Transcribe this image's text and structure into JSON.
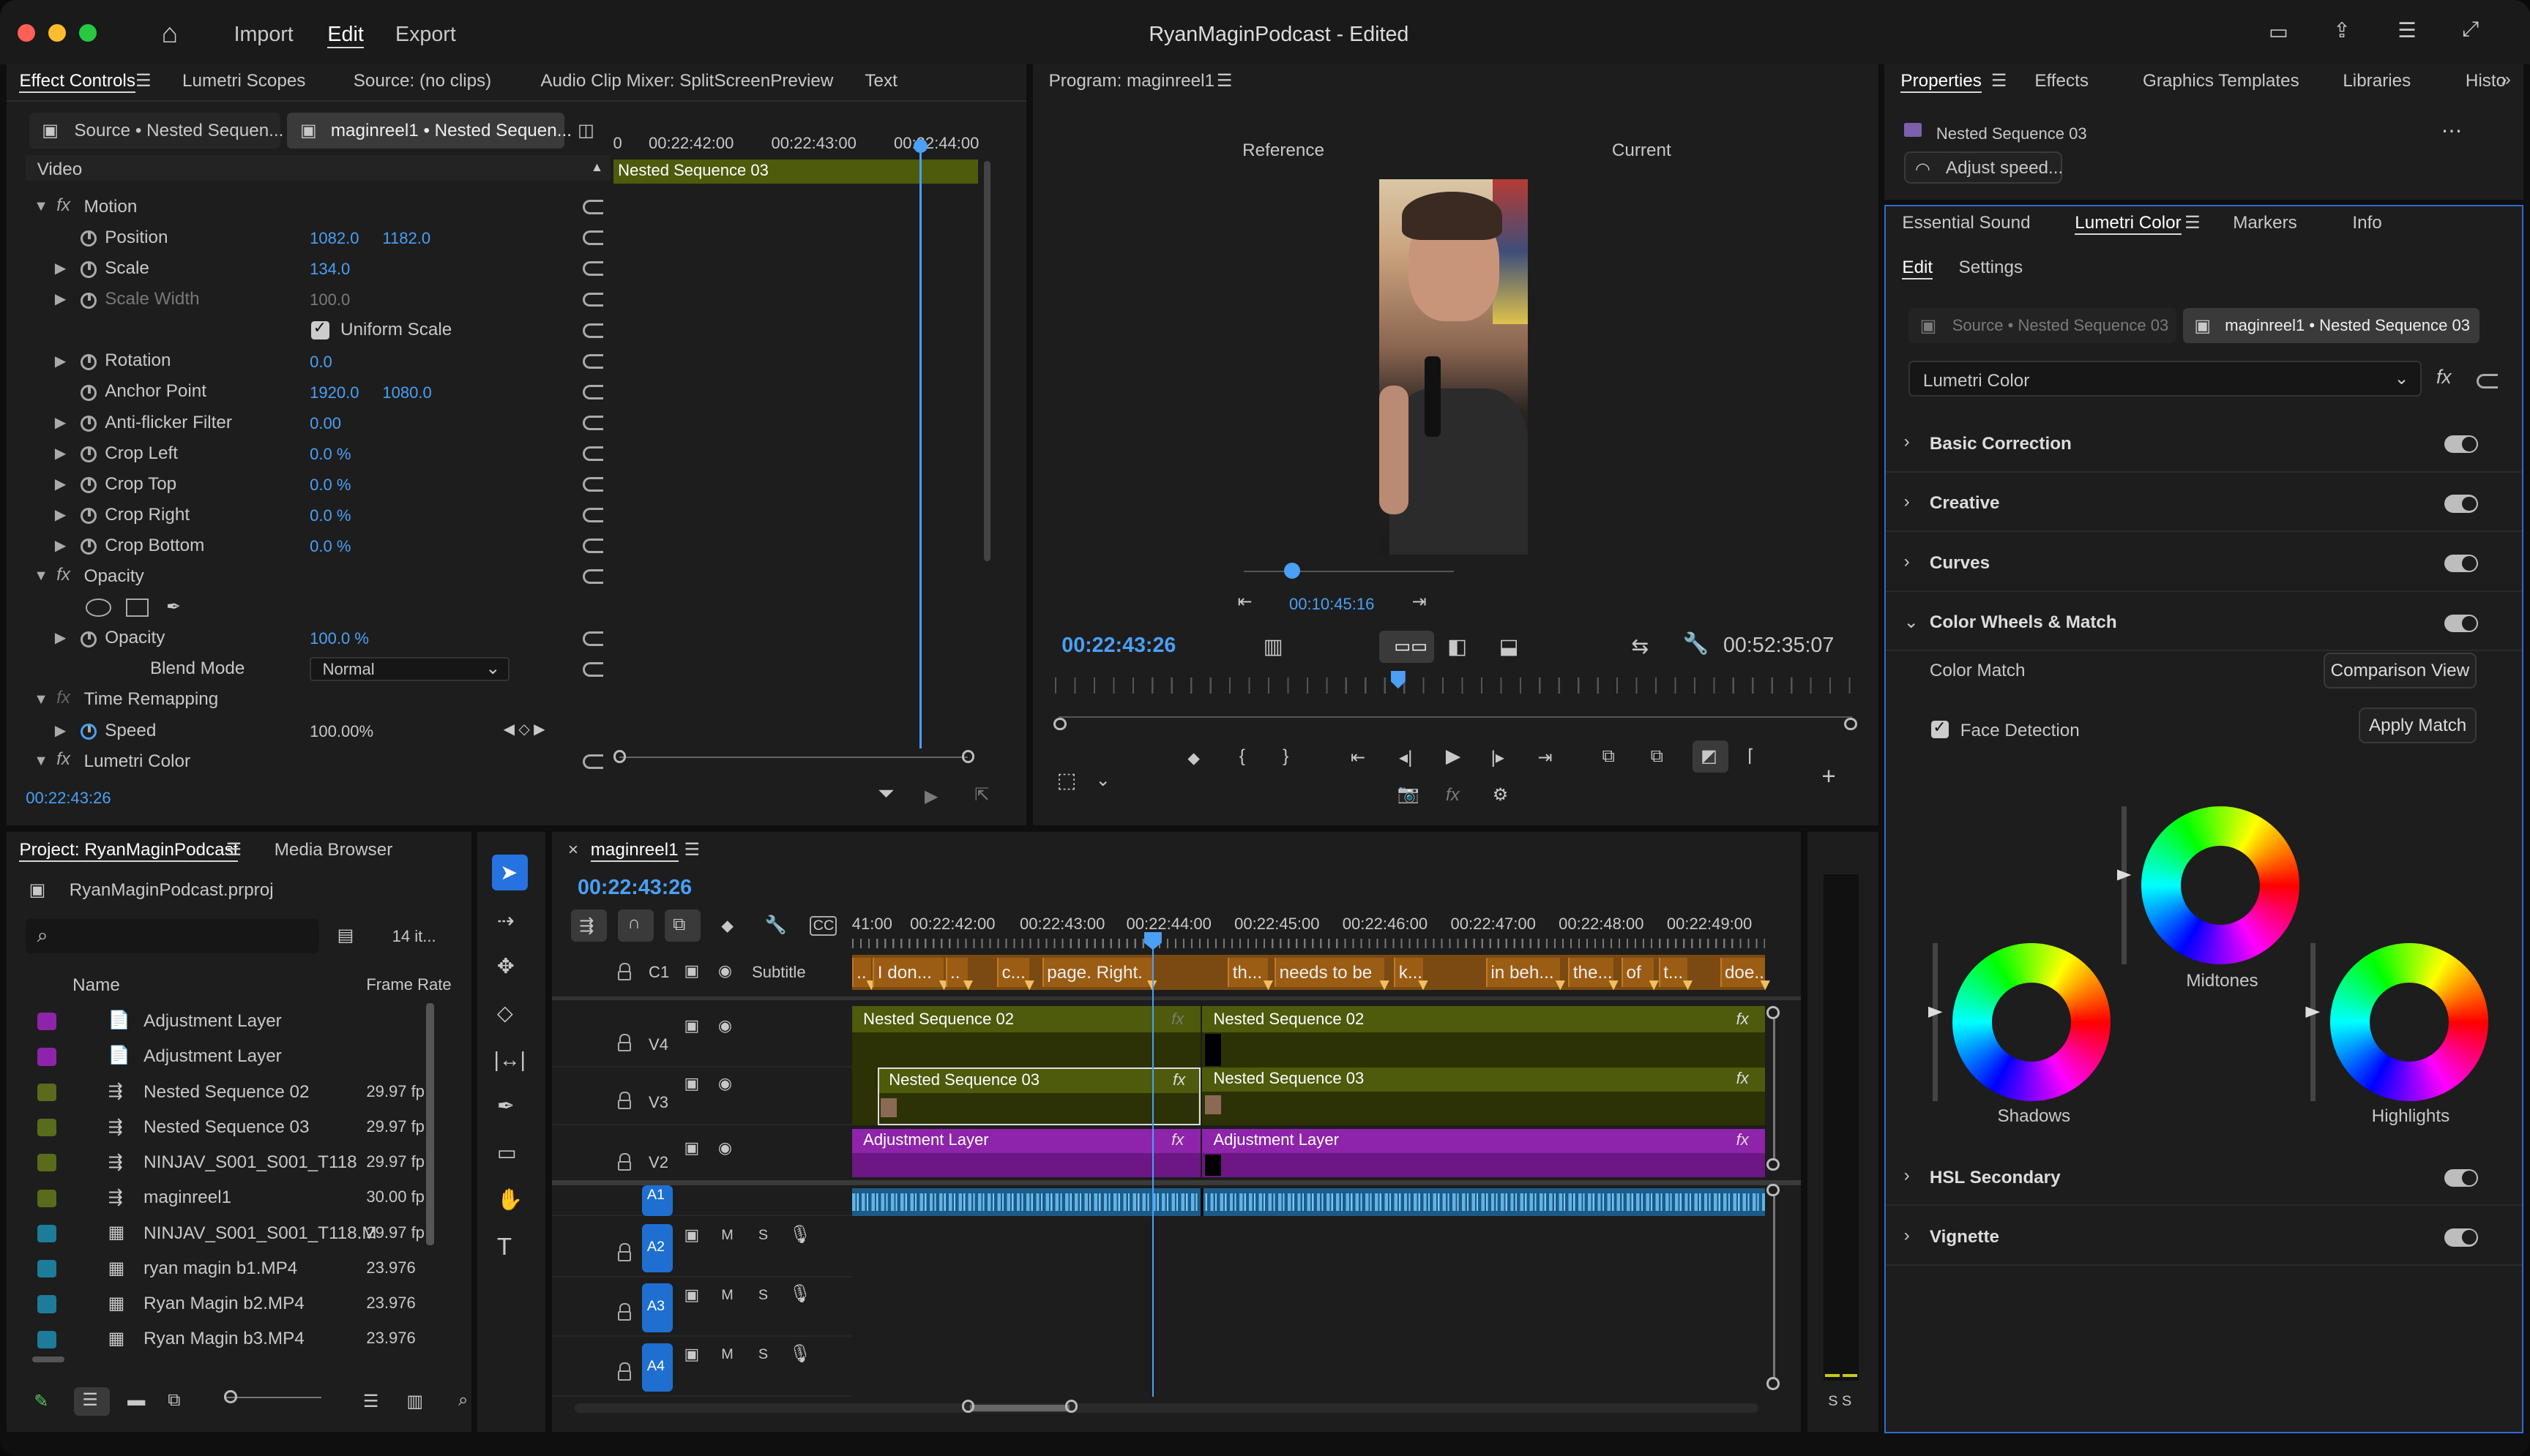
{
  "window": {
    "title": "RyanMaginPodcast - Edited",
    "menu": [
      "Import",
      "Edit",
      "Export"
    ]
  },
  "effect_controls": {
    "tabs": [
      "Effect Controls",
      "Lumetri Scopes",
      "Source: (no clips)",
      "Audio Clip Mixer: SplitScreenPreview",
      "Text"
    ],
    "source_tab": "Source • Nested Sequen...",
    "seq_tab": "maginreel1 • Nested Sequen...",
    "section": "Video",
    "ruler": [
      "00:22:42:00",
      "00:22:43:00",
      "00:22:44:00"
    ],
    "clip_label": "Nested Sequence 03",
    "rows": [
      {
        "label": "Motion"
      },
      {
        "label": "Position",
        "v1": "1082.0",
        "v2": "1182.0"
      },
      {
        "label": "Scale",
        "v1": "134.0"
      },
      {
        "label": "Scale Width",
        "v1": "100.0"
      },
      {
        "label": "Uniform Scale"
      },
      {
        "label": "Rotation",
        "v1": "0.0"
      },
      {
        "label": "Anchor Point",
        "v1": "1920.0",
        "v2": "1080.0"
      },
      {
        "label": "Anti-flicker Filter",
        "v1": "0.00"
      },
      {
        "label": "Crop Left",
        "v1": "0.0 %"
      },
      {
        "label": "Crop Top",
        "v1": "0.0 %"
      },
      {
        "label": "Crop Right",
        "v1": "0.0 %"
      },
      {
        "label": "Crop Bottom",
        "v1": "0.0 %"
      },
      {
        "label": "Opacity"
      },
      {
        "label": ""
      },
      {
        "label": "Opacity",
        "v1": "100.0 %"
      },
      {
        "label": "Blend Mode",
        "v1": "Normal"
      },
      {
        "label": "Time Remapping"
      },
      {
        "label": "Speed",
        "v1": "100.00%"
      },
      {
        "label": "Lumetri Color"
      }
    ],
    "timecode": "00:22:43:26"
  },
  "program": {
    "title": "Program: maginreel1",
    "reference": "Reference",
    "current": "Current",
    "mini_tc": "00:10:45:16",
    "tc_left": "00:22:43:26",
    "tc_right": "00:52:35:07"
  },
  "right_top": {
    "tabs": [
      "Properties",
      "Effects",
      "Graphics Templates",
      "Libraries",
      "Histo"
    ],
    "clip_name": "Nested Sequence 03",
    "adjust_speed": "Adjust speed..."
  },
  "lumetri": {
    "tabs": [
      "Essential Sound",
      "Lumetri Color",
      "Markers",
      "Info"
    ],
    "subtabs": [
      "Edit",
      "Settings"
    ],
    "source": "Source • Nested Sequence 03",
    "seq": "maginreel1 • Nested Sequence 03",
    "effect": "Lumetri Color",
    "sections": [
      "Basic Correction",
      "Creative",
      "Curves",
      "Color Wheels & Match"
    ],
    "color_match": "Color Match",
    "comparison_view": "Comparison View",
    "face_detection": "Face Detection",
    "apply_match": "Apply Match",
    "wheels": [
      "Midtones",
      "Shadows",
      "Highlights"
    ],
    "sections2": [
      "HSL Secondary",
      "Vignette"
    ]
  },
  "project": {
    "tabs": [
      "Project: RyanMaginPodcast",
      "Media Browser"
    ],
    "file": "RyanMaginPodcast.prproj",
    "count": "14 it...",
    "col_name": "Name",
    "col_rate": "Frame Rate",
    "items": [
      {
        "name": "Adjustment Layer",
        "rate": "",
        "color": "#8e24aa"
      },
      {
        "name": "Adjustment Layer",
        "rate": "",
        "color": "#8e24aa"
      },
      {
        "name": "Nested Sequence 02",
        "rate": "29.97 fp",
        "color": "#5b6b1c"
      },
      {
        "name": "Nested Sequence 03",
        "rate": "29.97 fp",
        "color": "#5b6b1c"
      },
      {
        "name": "NINJAV_S001_S001_T118",
        "rate": "29.97 fp",
        "color": "#5b6b1c"
      },
      {
        "name": "maginreel1",
        "rate": "30.00 fp",
        "color": "#5b6b1c"
      },
      {
        "name": "NINJAV_S001_S001_T118.M",
        "rate": "29.97 fp",
        "color": "#1d7c9a"
      },
      {
        "name": "ryan magin b1.MP4",
        "rate": "23.976",
        "color": "#1d7c9a"
      },
      {
        "name": "Ryan Magin b2.MP4",
        "rate": "23.976",
        "color": "#1d7c9a"
      },
      {
        "name": "Ryan Magin b3.MP4",
        "rate": "23.976",
        "color": "#1d7c9a"
      }
    ]
  },
  "timeline": {
    "tab": "maginreel1",
    "timecode": "00:22:43:26",
    "ruler": [
      "41:00",
      "00:22:42:00",
      "00:22:43:00",
      "00:22:44:00",
      "00:22:45:00",
      "00:22:46:00",
      "00:22:47:00",
      "00:22:48:00",
      "00:22:49:00"
    ],
    "tracks": [
      "C1",
      "V4",
      "V3",
      "V2",
      "A1",
      "A2",
      "A3",
      "A4"
    ],
    "subtitle_label": "Subtitle",
    "subs": [
      "..",
      "I don...",
      "..",
      "c...",
      "page. Right.",
      "th...",
      "needs to be",
      "k...",
      "in beh...",
      "the...",
      "of",
      "t...",
      "doe..."
    ],
    "clips": {
      "ns02": "Nested Sequence 02",
      "ns03": "Nested Sequence 03",
      "adj": "Adjustment Layer",
      "fx": "fx"
    },
    "m": "M",
    "s": "S"
  },
  "meter": {
    "labels": "S S"
  }
}
